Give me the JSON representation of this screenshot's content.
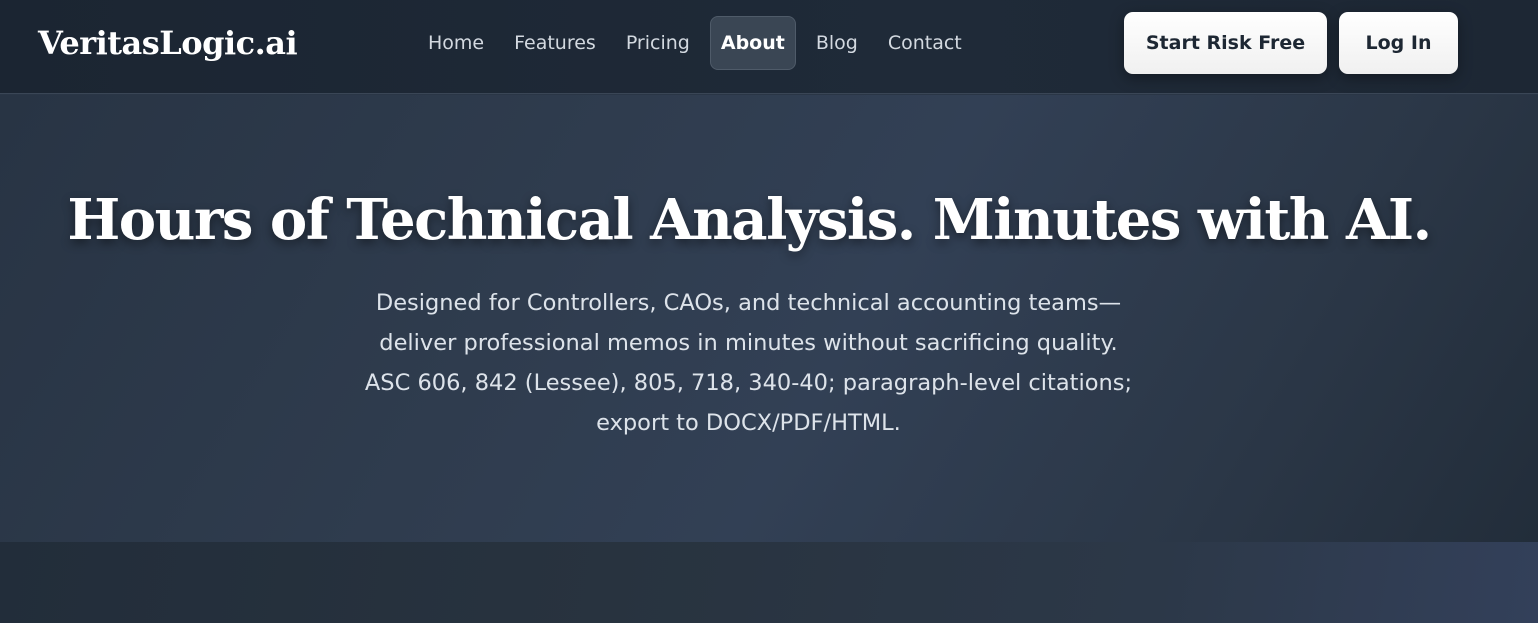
{
  "brand": {
    "name": "VeritasLogic.ai"
  },
  "nav": {
    "links": [
      {
        "label": "Home"
      },
      {
        "label": "Features"
      },
      {
        "label": "Pricing"
      },
      {
        "label": "About",
        "active": true
      },
      {
        "label": "Blog"
      },
      {
        "label": "Contact"
      }
    ]
  },
  "actions": {
    "start_label": "Start Risk Free",
    "login_label": "Log In"
  },
  "hero": {
    "title": "Hours of Technical Analysis. Minutes with AI.",
    "subtitle_lines": [
      "Designed for Controllers, CAOs, and technical accounting teams—",
      "deliver professional memos in minutes without sacrificing quality.",
      "ASC 606, 842 (Lessee), 805, 718, 340-40; paragraph-level citations;",
      "export to DOCX/PDF/HTML."
    ]
  },
  "colors": {
    "nav_background": "#1d2734",
    "hero_background": "#2f3c4e",
    "button_background": "#ffffff",
    "button_text": "#1d2733",
    "active_nav_background": "#3a4654"
  }
}
